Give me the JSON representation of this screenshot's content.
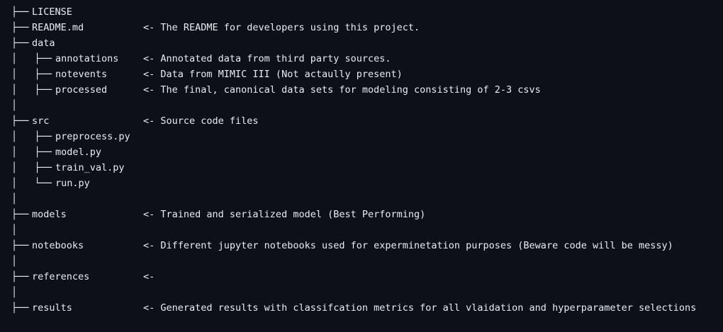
{
  "tree": {
    "rows": [
      {
        "prefix": "├──",
        "name": "LICENSE",
        "level": 1,
        "comment": ""
      },
      {
        "prefix": "├──",
        "name": "README.md",
        "level": 1,
        "comment": "<- The README for developers using this project."
      },
      {
        "prefix": "├──",
        "name": "data",
        "level": 1,
        "comment": ""
      },
      {
        "prefix": "│   ├──",
        "name": "annotations",
        "level": 2,
        "comment": "<- Annotated data from third party sources."
      },
      {
        "prefix": "│   ├──",
        "name": "notevents",
        "level": 2,
        "comment": "<- Data from MIMIC III (Not actaully present)"
      },
      {
        "prefix": "│   ├──",
        "name": "processed",
        "level": 2,
        "comment": "<- The final, canonical data sets for modeling consisting of 2-3 csvs"
      },
      {
        "prefix": "│",
        "name": "",
        "level": 0,
        "comment": ""
      },
      {
        "prefix": "├──",
        "name": "src",
        "level": 1,
        "comment": "<- Source code files"
      },
      {
        "prefix": "│   ├──",
        "name": "preprocess.py",
        "level": 2,
        "comment": ""
      },
      {
        "prefix": "│   ├──",
        "name": "model.py",
        "level": 2,
        "comment": ""
      },
      {
        "prefix": "│   ├──",
        "name": "train_val.py",
        "level": 2,
        "comment": ""
      },
      {
        "prefix": "│   └──",
        "name": "run.py",
        "level": 2,
        "comment": ""
      },
      {
        "prefix": "│",
        "name": "",
        "level": 0,
        "comment": ""
      },
      {
        "prefix": "├──",
        "name": "models",
        "level": 1,
        "comment": "<- Trained and serialized model (Best Performing)"
      },
      {
        "prefix": "│",
        "name": "",
        "level": 0,
        "comment": ""
      },
      {
        "prefix": "├──",
        "name": "notebooks",
        "level": 1,
        "comment": "<- Different jupyter notebooks used for experminetation purposes (Beware code will be messy)"
      },
      {
        "prefix": "│",
        "name": "",
        "level": 0,
        "comment": ""
      },
      {
        "prefix": "├──",
        "name": "references",
        "level": 1,
        "comment": "<-"
      },
      {
        "prefix": "│",
        "name": "",
        "level": 0,
        "comment": ""
      },
      {
        "prefix": "├──",
        "name": "results",
        "level": 1,
        "comment": "<- Generated results with classifcation metrics for all vlaidation and hyperparameter selections"
      }
    ]
  }
}
